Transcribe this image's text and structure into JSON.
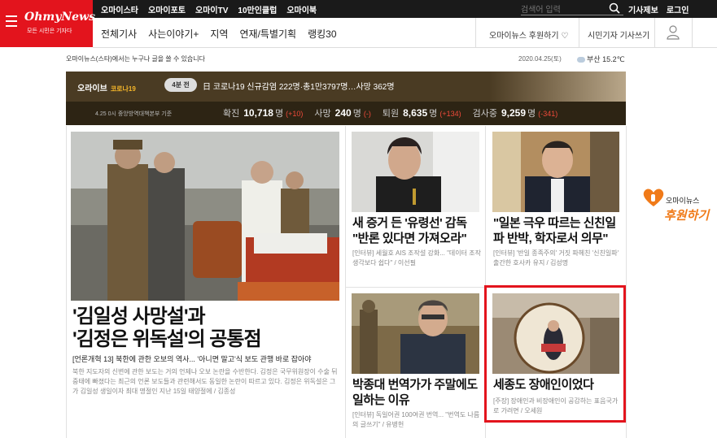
{
  "topbar": {
    "links": [
      "오마이스타",
      "오마이포토",
      "오마이TV",
      "10만인클럽",
      "오마이북"
    ],
    "search_placeholder": "검색어 입력",
    "right_links": [
      "기사제보",
      "로그인"
    ]
  },
  "logo": {
    "text": "OhmyNews",
    "tagline": "모든 시민은 기자다"
  },
  "nav": {
    "items": [
      "전체기사",
      "사는이야기+",
      "지역",
      "연재/특별기획",
      "랭킹30"
    ],
    "support": "오마이뉴스 후원하기 ♡",
    "citizen_reporter": "시민기자 기사쓰기"
  },
  "infoline": "오마이뉴스(스타)에서는 누구나 글을 쓸 수 있습니다",
  "date": "2020.04.25(토)",
  "weather": {
    "city": "부산",
    "temp": "15.2℃"
  },
  "banner": {
    "tag": "오라이브",
    "subtag": "코로나19",
    "time_pill": "4분 전",
    "headline": "日 코로나19 신규감염 222명·총1만3797명…사망 362명",
    "source": "4.25 0시 중앙방역대책본부 기준",
    "stats": [
      {
        "label": "확진",
        "value": "10,718",
        "unit": "명",
        "delta": "(+10)"
      },
      {
        "label": "사망",
        "value": "240",
        "unit": "명",
        "delta": "(-)"
      },
      {
        "label": "퇴원",
        "value": "8,635",
        "unit": "명",
        "delta": "(+134)"
      },
      {
        "label": "검사중",
        "value": "9,259",
        "unit": "명",
        "delta": "(-341)"
      }
    ]
  },
  "main_article": {
    "title_line1": "'김일성 사망설'과",
    "title_line2": "'김정은 위독설'의 공통점",
    "subtitle": "[언론개혁 13] 북한에 관한 오보의 역사... '아니면 말고'식 보도 관행 바로 잡아야",
    "body": "북한 지도자의 신변에 관한 보도는 거의 언제나 오보 논란을 수반한다. 김정은 국무위원장이 수술 뒤 중태에 빠졌다는 최근의 언론 보도들과 관련해서도 동일한 논란이 따르고 있다. 김정은 위독설은 그가 김일성 생일이자 최대 명절인 지난 15일 태양절에 / 김종성"
  },
  "cards": [
    {
      "title": "새 증거 든 '유령선' 감독 \"반론 있다면 가져오라\"",
      "desc": "[인터뷰] 세월호 AIS 조작설 강화... \"데이터 조작 생각보다 쉽다\" / 이선필"
    },
    {
      "title": "\"일본 극우 따르는 신친일파 반박, 학자로서 의무\"",
      "desc": "[인터뷰] '반일 종족주의' 거짓 파헤친 '신친일파' 출간한 호사카 유지 / 김성명"
    },
    {
      "title": "박종대 번역가가 주말에도 일하는 이유",
      "desc": "[인터뷰] 독일어권 100여권 번역... \"번역도 나름의 글쓰기\" / 유병헌"
    },
    {
      "title": "세종도 장애인이었다",
      "desc": "[주장] 장애인과 비장애인이 공감하는 표음국가로 가려면 / 오세원"
    }
  ],
  "donate": {
    "line1": "오마이뉴스",
    "line2": "후원하기"
  }
}
